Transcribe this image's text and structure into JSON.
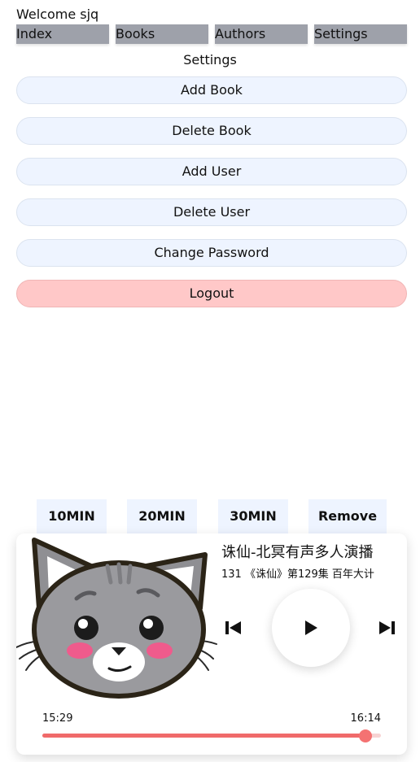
{
  "header": {
    "welcome": "Welcome sjq",
    "tabs": [
      {
        "label": "Index"
      },
      {
        "label": "Books"
      },
      {
        "label": "Authors"
      },
      {
        "label": "Settings"
      }
    ]
  },
  "settings": {
    "title": "Settings",
    "buttons": {
      "add_book": "Add Book",
      "delete_book": "Delete Book",
      "add_user": "Add User",
      "delete_user": "Delete User",
      "change_password": "Change Password",
      "logout": "Logout"
    }
  },
  "timer": {
    "options": [
      "10MIN",
      "20MIN",
      "30MIN"
    ],
    "remove": "Remove"
  },
  "player": {
    "title": "诛仙-北冥有声多人演播",
    "subtitle": "131 《诛仙》第129集 百年大计",
    "current_time": "15:29",
    "total_time": "16:14",
    "progress": 0.954,
    "cover_icon": "cat-face-icon",
    "accent_color": "#f06a6a"
  }
}
